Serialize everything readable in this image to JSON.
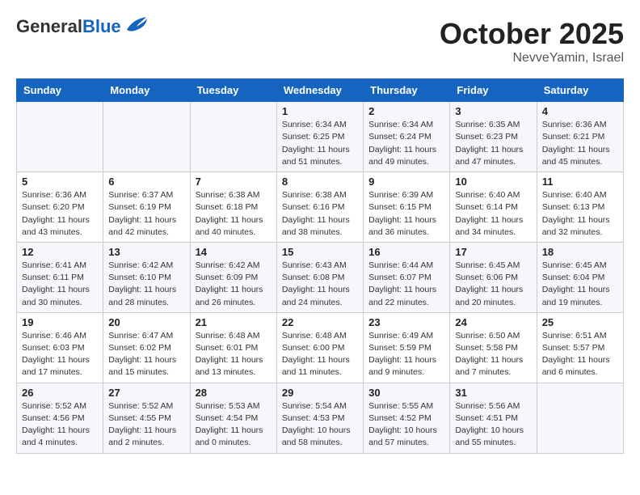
{
  "header": {
    "logo_general": "General",
    "logo_blue": "Blue",
    "title": "October 2025",
    "subtitle": "NevveYamin, Israel"
  },
  "weekdays": [
    "Sunday",
    "Monday",
    "Tuesday",
    "Wednesday",
    "Thursday",
    "Friday",
    "Saturday"
  ],
  "weeks": [
    [
      {
        "day": "",
        "sunrise": "",
        "sunset": "",
        "daylight": ""
      },
      {
        "day": "",
        "sunrise": "",
        "sunset": "",
        "daylight": ""
      },
      {
        "day": "",
        "sunrise": "",
        "sunset": "",
        "daylight": ""
      },
      {
        "day": "1",
        "sunrise": "Sunrise: 6:34 AM",
        "sunset": "Sunset: 6:25 PM",
        "daylight": "Daylight: 11 hours and 51 minutes."
      },
      {
        "day": "2",
        "sunrise": "Sunrise: 6:34 AM",
        "sunset": "Sunset: 6:24 PM",
        "daylight": "Daylight: 11 hours and 49 minutes."
      },
      {
        "day": "3",
        "sunrise": "Sunrise: 6:35 AM",
        "sunset": "Sunset: 6:23 PM",
        "daylight": "Daylight: 11 hours and 47 minutes."
      },
      {
        "day": "4",
        "sunrise": "Sunrise: 6:36 AM",
        "sunset": "Sunset: 6:21 PM",
        "daylight": "Daylight: 11 hours and 45 minutes."
      }
    ],
    [
      {
        "day": "5",
        "sunrise": "Sunrise: 6:36 AM",
        "sunset": "Sunset: 6:20 PM",
        "daylight": "Daylight: 11 hours and 43 minutes."
      },
      {
        "day": "6",
        "sunrise": "Sunrise: 6:37 AM",
        "sunset": "Sunset: 6:19 PM",
        "daylight": "Daylight: 11 hours and 42 minutes."
      },
      {
        "day": "7",
        "sunrise": "Sunrise: 6:38 AM",
        "sunset": "Sunset: 6:18 PM",
        "daylight": "Daylight: 11 hours and 40 minutes."
      },
      {
        "day": "8",
        "sunrise": "Sunrise: 6:38 AM",
        "sunset": "Sunset: 6:16 PM",
        "daylight": "Daylight: 11 hours and 38 minutes."
      },
      {
        "day": "9",
        "sunrise": "Sunrise: 6:39 AM",
        "sunset": "Sunset: 6:15 PM",
        "daylight": "Daylight: 11 hours and 36 minutes."
      },
      {
        "day": "10",
        "sunrise": "Sunrise: 6:40 AM",
        "sunset": "Sunset: 6:14 PM",
        "daylight": "Daylight: 11 hours and 34 minutes."
      },
      {
        "day": "11",
        "sunrise": "Sunrise: 6:40 AM",
        "sunset": "Sunset: 6:13 PM",
        "daylight": "Daylight: 11 hours and 32 minutes."
      }
    ],
    [
      {
        "day": "12",
        "sunrise": "Sunrise: 6:41 AM",
        "sunset": "Sunset: 6:11 PM",
        "daylight": "Daylight: 11 hours and 30 minutes."
      },
      {
        "day": "13",
        "sunrise": "Sunrise: 6:42 AM",
        "sunset": "Sunset: 6:10 PM",
        "daylight": "Daylight: 11 hours and 28 minutes."
      },
      {
        "day": "14",
        "sunrise": "Sunrise: 6:42 AM",
        "sunset": "Sunset: 6:09 PM",
        "daylight": "Daylight: 11 hours and 26 minutes."
      },
      {
        "day": "15",
        "sunrise": "Sunrise: 6:43 AM",
        "sunset": "Sunset: 6:08 PM",
        "daylight": "Daylight: 11 hours and 24 minutes."
      },
      {
        "day": "16",
        "sunrise": "Sunrise: 6:44 AM",
        "sunset": "Sunset: 6:07 PM",
        "daylight": "Daylight: 11 hours and 22 minutes."
      },
      {
        "day": "17",
        "sunrise": "Sunrise: 6:45 AM",
        "sunset": "Sunset: 6:06 PM",
        "daylight": "Daylight: 11 hours and 20 minutes."
      },
      {
        "day": "18",
        "sunrise": "Sunrise: 6:45 AM",
        "sunset": "Sunset: 6:04 PM",
        "daylight": "Daylight: 11 hours and 19 minutes."
      }
    ],
    [
      {
        "day": "19",
        "sunrise": "Sunrise: 6:46 AM",
        "sunset": "Sunset: 6:03 PM",
        "daylight": "Daylight: 11 hours and 17 minutes."
      },
      {
        "day": "20",
        "sunrise": "Sunrise: 6:47 AM",
        "sunset": "Sunset: 6:02 PM",
        "daylight": "Daylight: 11 hours and 15 minutes."
      },
      {
        "day": "21",
        "sunrise": "Sunrise: 6:48 AM",
        "sunset": "Sunset: 6:01 PM",
        "daylight": "Daylight: 11 hours and 13 minutes."
      },
      {
        "day": "22",
        "sunrise": "Sunrise: 6:48 AM",
        "sunset": "Sunset: 6:00 PM",
        "daylight": "Daylight: 11 hours and 11 minutes."
      },
      {
        "day": "23",
        "sunrise": "Sunrise: 6:49 AM",
        "sunset": "Sunset: 5:59 PM",
        "daylight": "Daylight: 11 hours and 9 minutes."
      },
      {
        "day": "24",
        "sunrise": "Sunrise: 6:50 AM",
        "sunset": "Sunset: 5:58 PM",
        "daylight": "Daylight: 11 hours and 7 minutes."
      },
      {
        "day": "25",
        "sunrise": "Sunrise: 6:51 AM",
        "sunset": "Sunset: 5:57 PM",
        "daylight": "Daylight: 11 hours and 6 minutes."
      }
    ],
    [
      {
        "day": "26",
        "sunrise": "Sunrise: 5:52 AM",
        "sunset": "Sunset: 4:56 PM",
        "daylight": "Daylight: 11 hours and 4 minutes."
      },
      {
        "day": "27",
        "sunrise": "Sunrise: 5:52 AM",
        "sunset": "Sunset: 4:55 PM",
        "daylight": "Daylight: 11 hours and 2 minutes."
      },
      {
        "day": "28",
        "sunrise": "Sunrise: 5:53 AM",
        "sunset": "Sunset: 4:54 PM",
        "daylight": "Daylight: 11 hours and 0 minutes."
      },
      {
        "day": "29",
        "sunrise": "Sunrise: 5:54 AM",
        "sunset": "Sunset: 4:53 PM",
        "daylight": "Daylight: 10 hours and 58 minutes."
      },
      {
        "day": "30",
        "sunrise": "Sunrise: 5:55 AM",
        "sunset": "Sunset: 4:52 PM",
        "daylight": "Daylight: 10 hours and 57 minutes."
      },
      {
        "day": "31",
        "sunrise": "Sunrise: 5:56 AM",
        "sunset": "Sunset: 4:51 PM",
        "daylight": "Daylight: 10 hours and 55 minutes."
      },
      {
        "day": "",
        "sunrise": "",
        "sunset": "",
        "daylight": ""
      }
    ]
  ]
}
